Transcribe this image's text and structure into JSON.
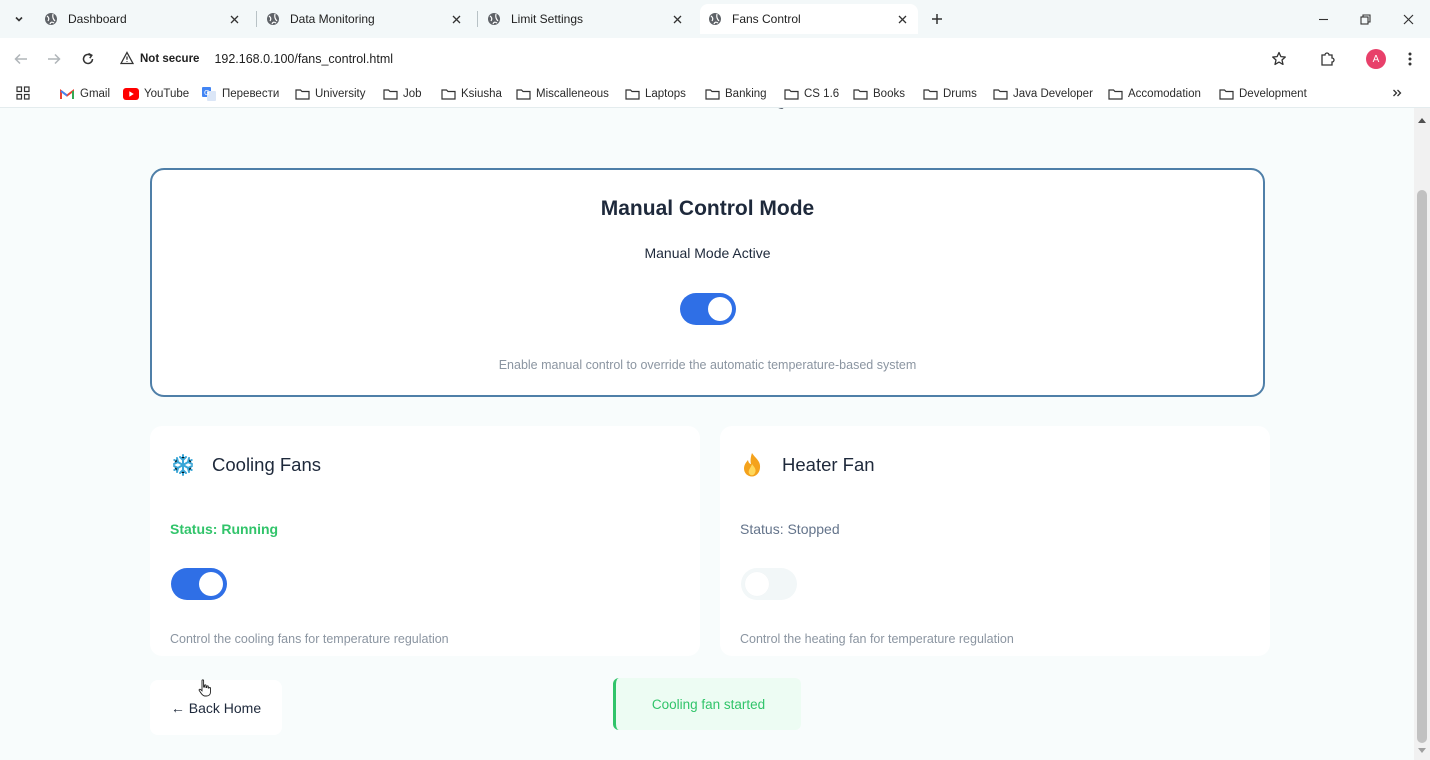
{
  "browser": {
    "tabs": [
      {
        "title": "Dashboard",
        "active": false
      },
      {
        "title": "Data Monitoring",
        "active": false
      },
      {
        "title": "Limit Settings",
        "active": false
      },
      {
        "title": "Fans Control",
        "active": true
      }
    ],
    "security_label": "Not secure",
    "url": "192.168.0.100/fans_control.html",
    "profile_initial": "A",
    "bookmarks": [
      {
        "label": "Gmail",
        "icon": "gmail-icon"
      },
      {
        "label": "YouTube",
        "icon": "youtube-icon"
      },
      {
        "label": "Перевести",
        "icon": "translate-icon"
      },
      {
        "label": "University",
        "icon": "folder-icon"
      },
      {
        "label": "Job",
        "icon": "folder-icon"
      },
      {
        "label": "Ksiusha",
        "icon": "folder-icon"
      },
      {
        "label": "Miscalleneous",
        "icon": "folder-icon"
      },
      {
        "label": "Laptops",
        "icon": "folder-icon"
      },
      {
        "label": "Banking",
        "icon": "folder-icon"
      },
      {
        "label": "CS 1.6",
        "icon": "folder-icon"
      },
      {
        "label": "Books",
        "icon": "folder-icon"
      },
      {
        "label": "Drums",
        "icon": "folder-icon"
      },
      {
        "label": "Java Developer",
        "icon": "folder-icon"
      },
      {
        "label": "Accomodation",
        "icon": "folder-icon"
      },
      {
        "label": "Development",
        "icon": "folder-icon"
      }
    ]
  },
  "manual": {
    "title": "Manual Control Mode",
    "status": "Manual Mode Active",
    "enabled": true,
    "description": "Enable manual control to override the automatic temperature-based system"
  },
  "fans": {
    "cooling": {
      "title": "Cooling Fans",
      "icon": "snowflake-icon",
      "status": "Status: Running",
      "enabled": true,
      "description": "Control the cooling fans for temperature regulation"
    },
    "heater": {
      "title": "Heater Fan",
      "icon": "flame-icon",
      "status": "Status: Stopped",
      "enabled": false,
      "description": "Control the heating fan for temperature regulation"
    }
  },
  "back_button": "← Back Home",
  "toast": "Cooling fan started",
  "colors": {
    "accent": "#2f6fe6",
    "running": "#31c46a",
    "card_border": "#4f7fa8"
  }
}
